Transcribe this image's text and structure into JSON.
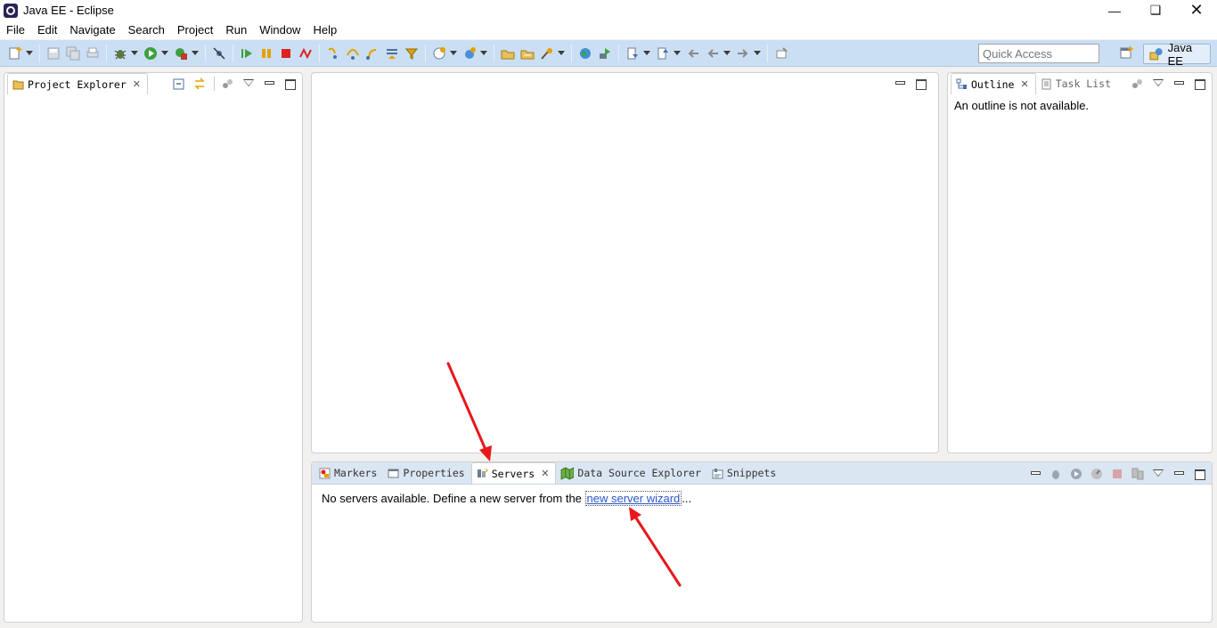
{
  "window": {
    "title": "Java EE - Eclipse",
    "controls": [
      "minimize",
      "restore",
      "close"
    ]
  },
  "menu": [
    {
      "label": "File"
    },
    {
      "label": "Edit"
    },
    {
      "label": "Navigate"
    },
    {
      "label": "Search"
    },
    {
      "label": "Project"
    },
    {
      "label": "Run"
    },
    {
      "label": "Window"
    },
    {
      "label": "Help"
    }
  ],
  "toolbar": {
    "quick_access_placeholder": "Quick Access",
    "perspective_label": "Java EE",
    "icons": [
      "new-icon",
      "save-icon",
      "save-all-icon",
      "print-icon",
      "debug-icon",
      "run-icon",
      "external-tools-icon",
      "skip-breakpoints-icon",
      "resume-icon",
      "suspend-icon",
      "terminate-icon",
      "disconnect-icon",
      "step-into-icon",
      "step-over-icon",
      "step-return-icon",
      "drop-to-frame-icon",
      "use-step-filters-icon",
      "new-server-icon",
      "new-web-service-icon",
      "open-type-icon",
      "open-task-icon",
      "search-icon",
      "web-browser-icon",
      "deploy-icon",
      "next-annotation-icon",
      "previous-annotation-icon",
      "back-icon",
      "forward-icon",
      "pin-editor-icon"
    ]
  },
  "project_explorer": {
    "tab_label": "Project Explorer"
  },
  "outline_panel": {
    "tabs": [
      {
        "label": "Outline"
      },
      {
        "label": "Task List"
      }
    ],
    "message": "An outline is not available."
  },
  "bottom_panel": {
    "tabs": [
      {
        "label": "Markers"
      },
      {
        "label": "Properties"
      },
      {
        "label": "Servers"
      },
      {
        "label": "Data Source Explorer"
      },
      {
        "label": "Snippets"
      }
    ],
    "message_prefix": "No servers available. Define a new server from the ",
    "link_text": "new server wizard",
    "message_suffix": "..."
  },
  "colors": {
    "toolbar_bg": "#cbdff4",
    "annotation_arrow": "#e8161b",
    "link": "#2a56c6"
  }
}
